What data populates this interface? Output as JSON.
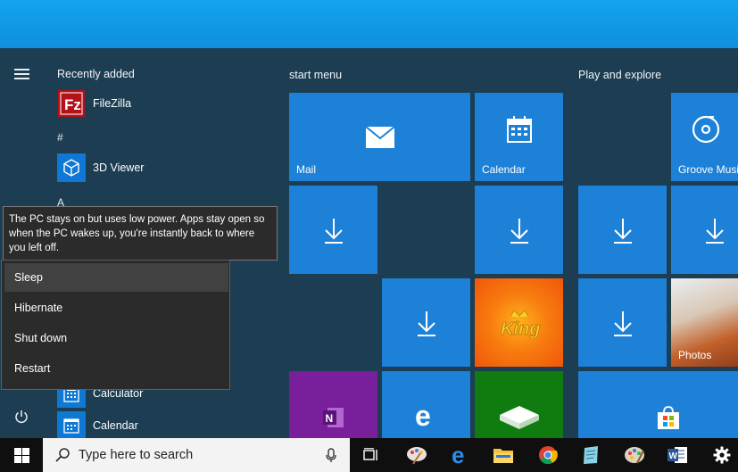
{
  "start_menu": {
    "recently_added_heading": "Recently added",
    "apps_recent": [
      {
        "label": "FileZilla",
        "icon": "filezilla-icon"
      },
      {
        "label": "3D Viewer",
        "icon": "3d-viewer-icon"
      }
    ],
    "letter_hash": "#",
    "letter_a": "A",
    "apps_below": [
      {
        "label": "Calculator",
        "icon": "calculator-icon"
      },
      {
        "label": "Calendar",
        "icon": "calendar-icon"
      }
    ],
    "group_start_menu": "start menu",
    "group_play_explore": "Play and explore"
  },
  "tiles": {
    "mail": "Mail",
    "calendar": "Calendar",
    "groove": "Groove Music",
    "photos": "Photos"
  },
  "power": {
    "tooltip": "The PC stays on but uses low power. Apps stay open so when the PC wakes up, you're instantly back to where you left off.",
    "items": [
      "Sleep",
      "Hibernate",
      "Shut down",
      "Restart"
    ],
    "selected": "Sleep"
  },
  "taskbar": {
    "search_placeholder": "Type here to search"
  },
  "colors": {
    "tile_blue": "#1d81d8",
    "start_bg": "#1c3d52",
    "onenote_purple": "#7a1f9c",
    "candy_orange": "#f45b0b",
    "xbox_green": "#107c10",
    "desktop_blue": "#14a3ee"
  }
}
